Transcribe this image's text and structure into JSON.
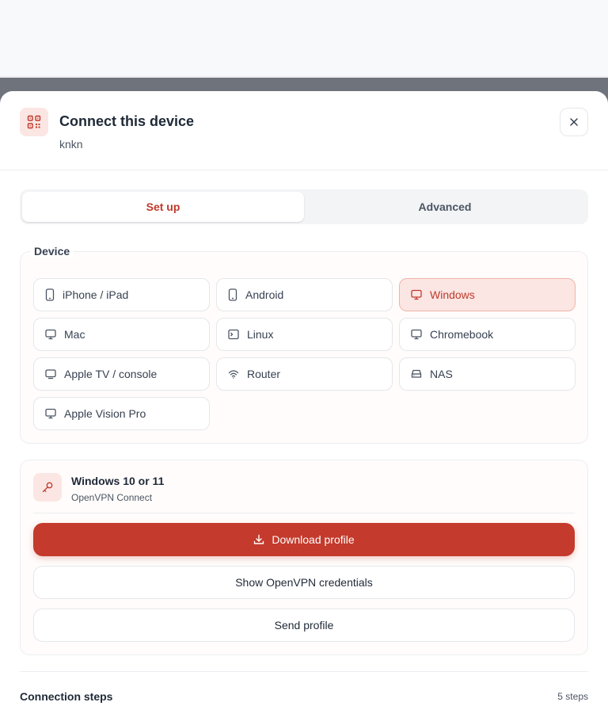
{
  "dialog": {
    "title": "Connect this device",
    "subtitle": "knkn"
  },
  "tabs": [
    {
      "label": "Set up",
      "active": true
    },
    {
      "label": "Advanced",
      "active": false
    }
  ],
  "device_section": {
    "legend": "Device",
    "options": [
      {
        "label": "iPhone / iPad",
        "icon": "phone-icon",
        "selected": false
      },
      {
        "label": "Android",
        "icon": "phone-icon",
        "selected": false
      },
      {
        "label": "Windows",
        "icon": "monitor-icon",
        "selected": true
      },
      {
        "label": "Mac",
        "icon": "monitor-icon",
        "selected": false
      },
      {
        "label": "Linux",
        "icon": "terminal-icon",
        "selected": false
      },
      {
        "label": "Chromebook",
        "icon": "monitor-icon",
        "selected": false
      },
      {
        "label": "Apple TV / console",
        "icon": "tv-icon",
        "selected": false
      },
      {
        "label": "Router",
        "icon": "wifi-icon",
        "selected": false
      },
      {
        "label": "NAS",
        "icon": "storage-icon",
        "selected": false
      },
      {
        "label": "Apple Vision Pro",
        "icon": "monitor-icon",
        "selected": false
      }
    ]
  },
  "profile": {
    "title": "Windows 10 or 11",
    "client": "OpenVPN Connect",
    "download_label": "Download profile",
    "credentials_label": "Show OpenVPN credentials",
    "send_label": "Send profile"
  },
  "steps": {
    "title": "Connection steps",
    "count": "5 steps"
  },
  "colors": {
    "accent": "#c43a2c",
    "accent_soft": "#fbe6e3"
  }
}
